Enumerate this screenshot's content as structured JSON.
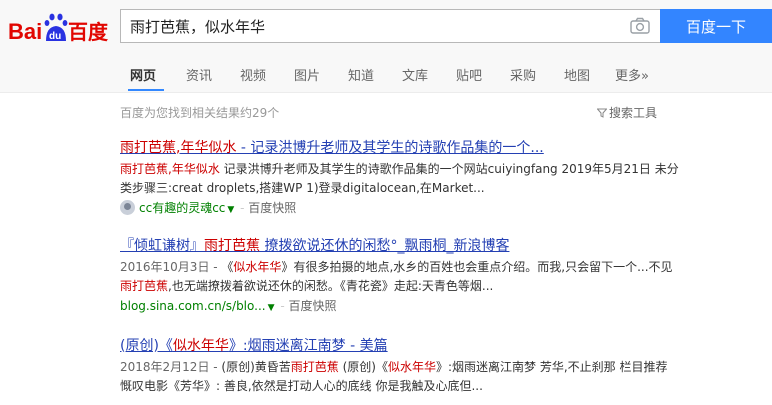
{
  "logo": {
    "bai": "Bai",
    "du": "du",
    "baidu_cn": "百度"
  },
  "search": {
    "query": "雨打芭蕉，似水年华",
    "button_label": "百度一下"
  },
  "nav": {
    "items": [
      {
        "label": "网页"
      },
      {
        "label": "资讯"
      },
      {
        "label": "视频"
      },
      {
        "label": "图片"
      },
      {
        "label": "知道"
      },
      {
        "label": "文库"
      },
      {
        "label": "贴吧"
      },
      {
        "label": "采购"
      },
      {
        "label": "地图"
      },
      {
        "label": "更多»"
      }
    ]
  },
  "summary": "百度为您找到相关结果约29个",
  "tools_label": "搜索工具",
  "results": [
    {
      "title_hl1": "雨打芭蕉",
      "title_mid": ",",
      "title_hl2": "年华似水",
      "title_rest": " - 记录洪博升老师及其学生的诗歌作品集的一个...",
      "abs_hl1": "雨打芭蕉",
      "abs_mid": ",",
      "abs_hl2": "年华似水",
      "abs_rest": " 记录洪博升老师及其学生的诗歌作品集的一个网站cuiyingfang 2019年5月21日 未分类步骤三:creat droplets,搭建WP 1)登录digitalocean,在Market...",
      "source": "cc有趣的灵魂cc",
      "snapshot": "百度快照"
    },
    {
      "title_pre": "『倾虹谦树』",
      "title_hl": "雨打芭蕉",
      "title_rest": " 撩拨欲说还休的闲愁°_飘雨桐_新浪博客",
      "date": "2016年10月3日 - ",
      "abs_a": "《",
      "abs_hl1": "似水年华",
      "abs_b": "》有很多拍摄的地点,水乡的百姓也会重点介绍。而我,只会留下一个...不见",
      "abs_hl2": "雨打芭蕉",
      "abs_c": ",也无端撩拨着欲说还休的闲愁。《青花瓷》走起:天青色等烟...",
      "source": "blog.sina.com.cn/s/blo...",
      "snapshot": "百度快照"
    },
    {
      "title_pre": "(原创)《",
      "title_hl": "似水年华",
      "title_rest": "》:烟雨迷离江南梦 - 美篇",
      "date": "2018年2月12日 - ",
      "abs_a": "(原创)黄昏苦",
      "abs_hl1": "雨打芭蕉",
      "abs_b": " (原创)《",
      "abs_hl2": "似水年华",
      "abs_c": "》:烟雨迷离江南梦 芳华,不止刹那 栏目推荐 慨叹电影《芳华》: 善良,依然是打动人心的底线 你是我触及心底但..."
    }
  ],
  "colors": {
    "accent": "#3385ff",
    "link": "#2440b3",
    "highlight": "#cc0000",
    "url": "#008000"
  },
  "icons": {
    "camera": "camera-icon",
    "filter": "filter-icon"
  }
}
